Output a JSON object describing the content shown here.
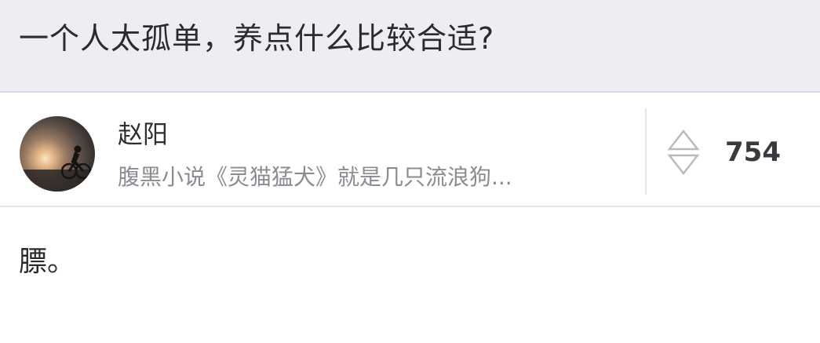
{
  "question": {
    "title": "一个人太孤单，养点什么比较合适?"
  },
  "answer": {
    "author": {
      "name": "赵阳",
      "bio": "腹黑小说《灵猫猛犬》就是几只流浪狗..."
    },
    "votes": "754",
    "content": "膘。"
  },
  "colors": {
    "question_bg": "#eeedf4",
    "title_text": "#2b2b2e",
    "bio_text": "#8b8b92",
    "divider": "#e4e4e8",
    "vote_icon": "#b9b9c0"
  }
}
